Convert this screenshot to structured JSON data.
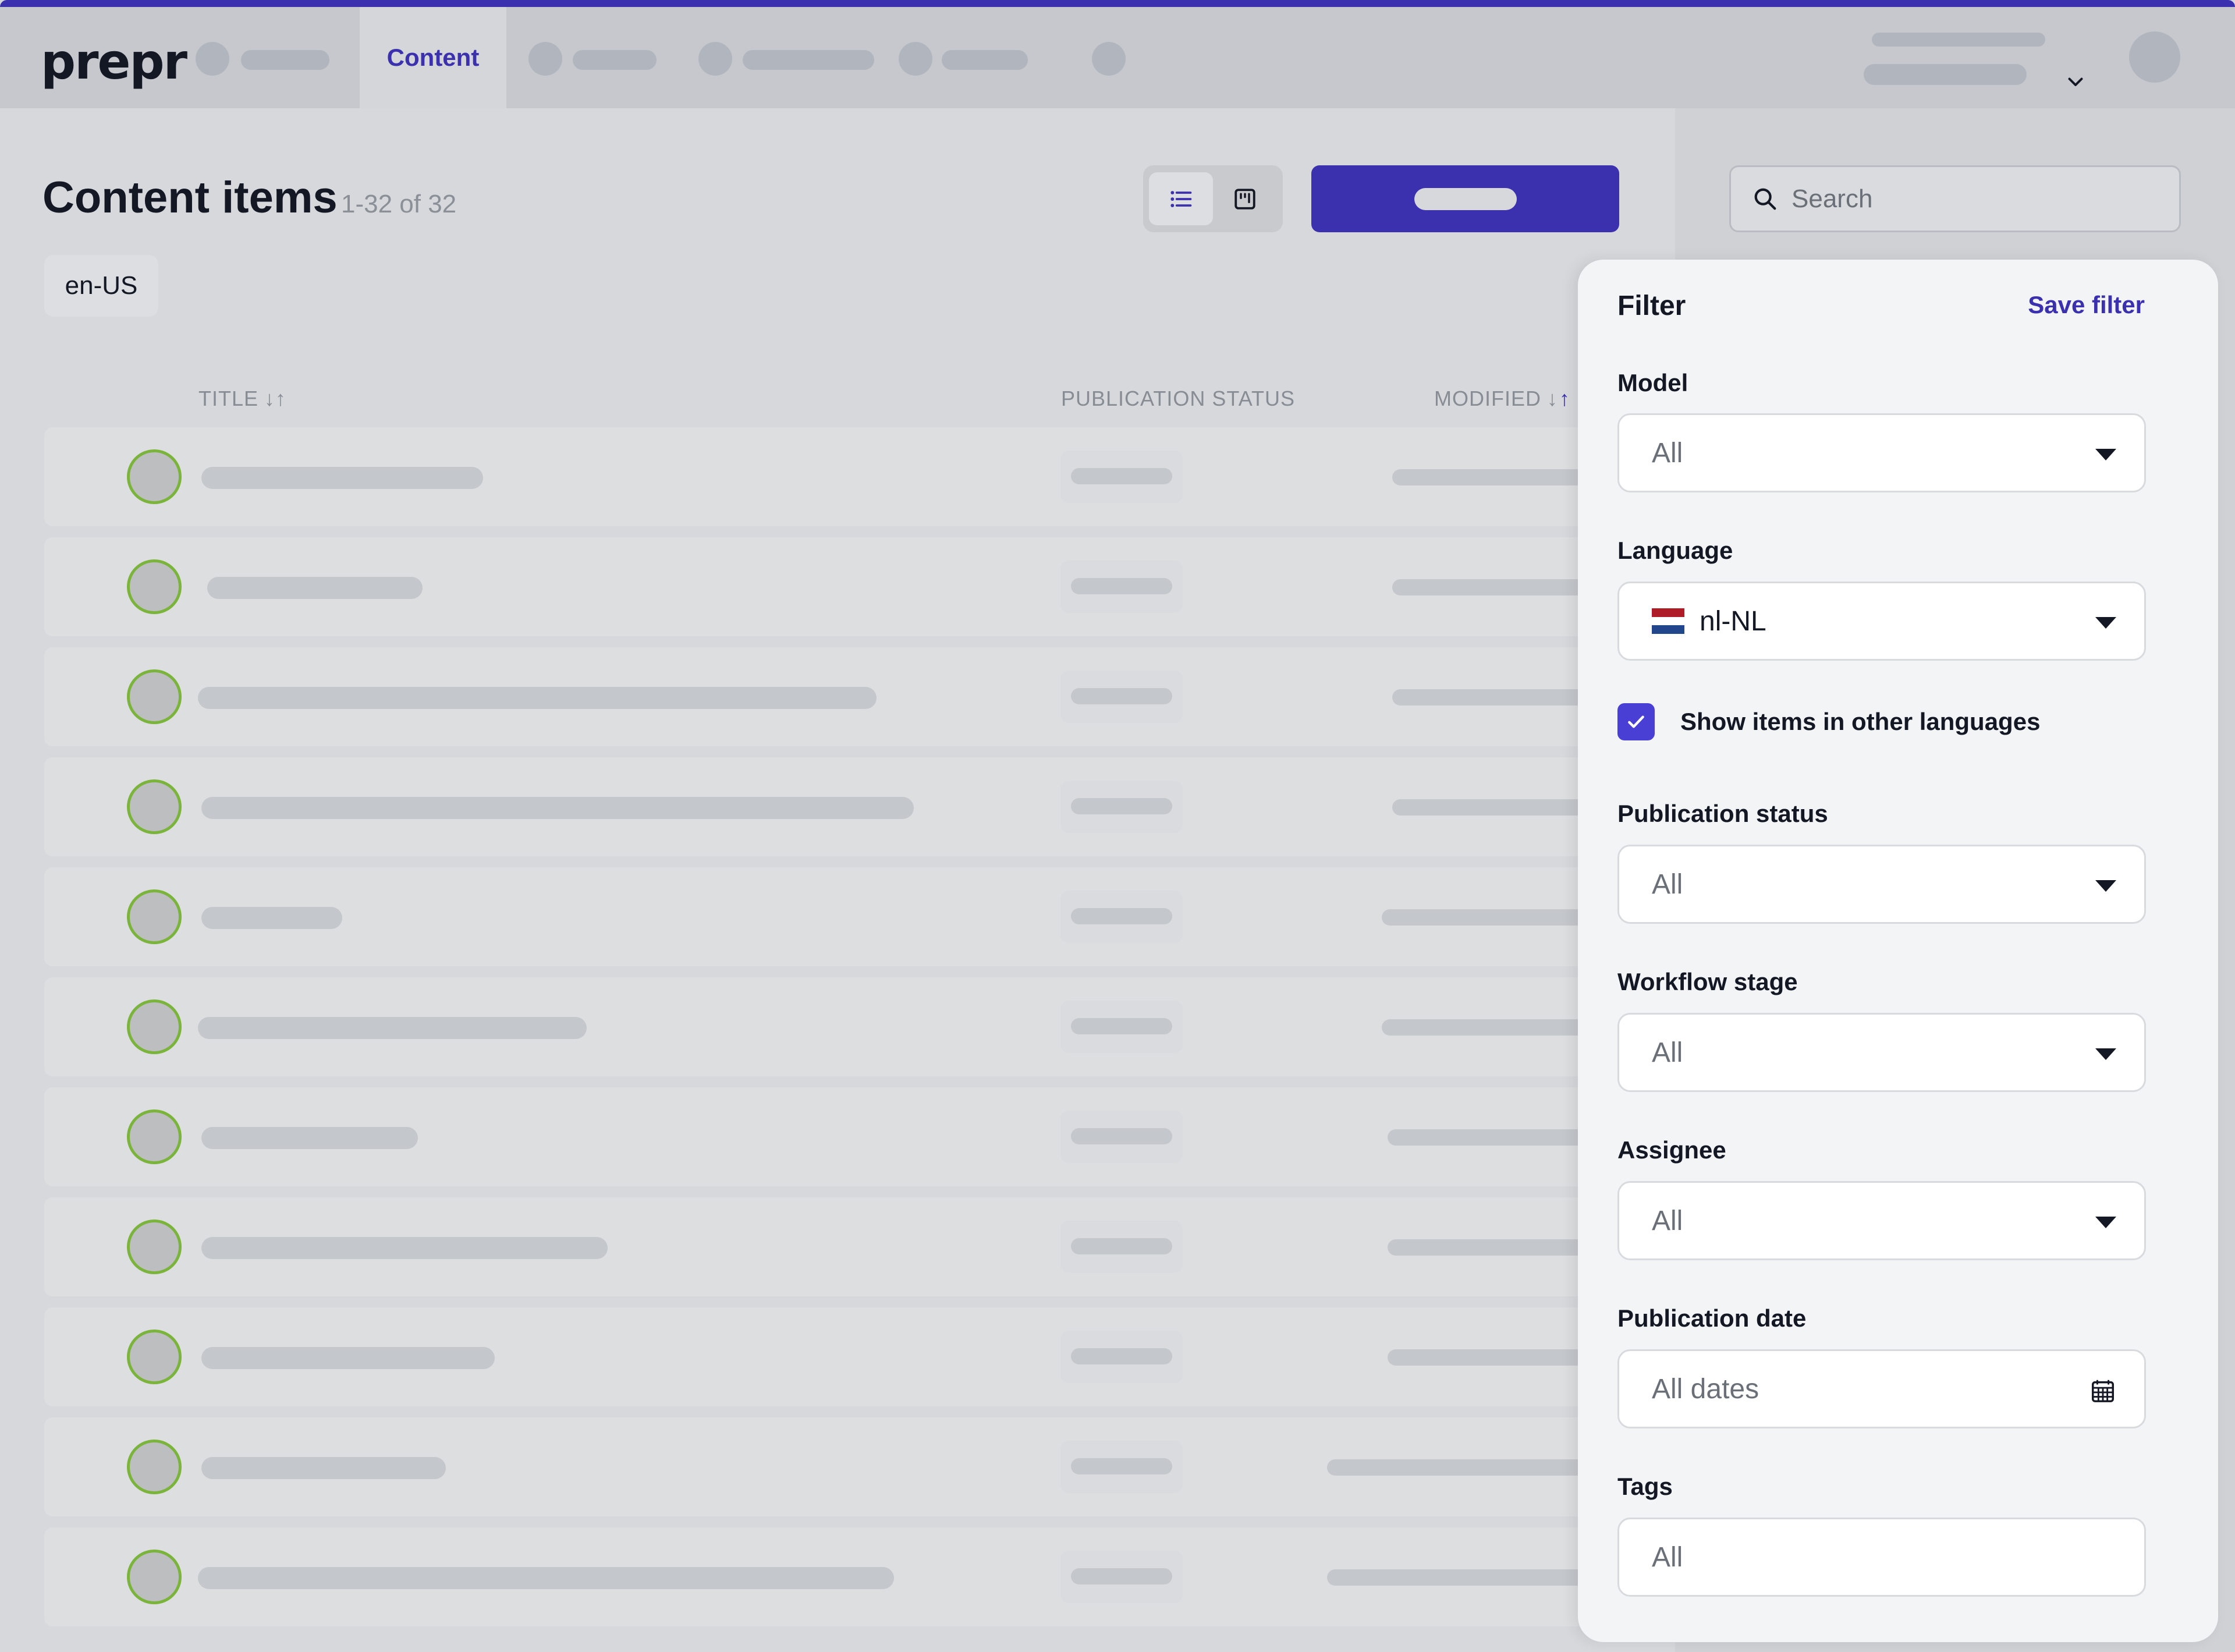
{
  "app": {
    "logo": "prepr",
    "accent_color": "#3b30ad"
  },
  "nav": {
    "active_tab": "Content"
  },
  "page": {
    "title": "Content items",
    "count": "1-32 of 32",
    "locale_chip": "en-US"
  },
  "toolbar": {
    "view_list_icon": "list-icon",
    "view_kanban_icon": "kanban-icon"
  },
  "search": {
    "placeholder": "Search"
  },
  "table": {
    "columns": [
      {
        "label": "TITLE",
        "sort": "↓↑"
      },
      {
        "label": "PUBLICATION STATUS"
      },
      {
        "label": "MODIFIED",
        "sort": "↓↑",
        "active_sort": "asc"
      }
    ],
    "rows_loading": 11
  },
  "filter": {
    "title": "Filter",
    "save_label": "Save filter",
    "model": {
      "label": "Model",
      "value": "All"
    },
    "language": {
      "label": "Language",
      "value": "nl-NL",
      "flag": "netherlands-flag"
    },
    "show_other_languages": {
      "label": "Show items in other languages",
      "checked": true
    },
    "publication_status": {
      "label": "Publication status",
      "value": "All"
    },
    "workflow_stage": {
      "label": "Workflow stage",
      "value": "All"
    },
    "assignee": {
      "label": "Assignee",
      "value": "All"
    },
    "publication_date": {
      "label": "Publication date",
      "placeholder": "All dates"
    },
    "tags": {
      "label": "Tags",
      "placeholder": "All"
    }
  }
}
